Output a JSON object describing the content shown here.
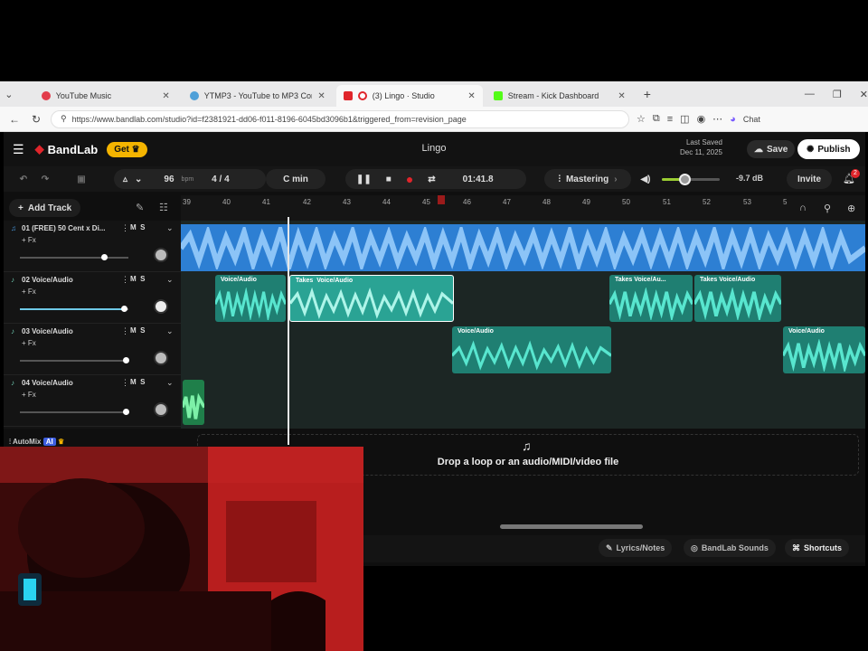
{
  "browser": {
    "tabs": [
      {
        "label": "YouTube Music",
        "color": "#e23c4b"
      },
      {
        "label": "YTMP3 - YouTube to MP3 Convert",
        "color": "#4fa0d8"
      },
      {
        "label": "(3) Lingo · Studio",
        "color": "#e0252b"
      },
      {
        "label": "Stream - Kick Dashboard",
        "color": "#53fc18"
      }
    ],
    "url": "https://www.bandlab.com/studio?id=f2381921-dd06-f011-8196-6045bd3096b1&triggered_from=revision_page",
    "chat_label": "Chat"
  },
  "app": {
    "brand": "BandLab",
    "get_label": "Get",
    "project_title": "Lingo",
    "last_saved_label": "Last Saved",
    "last_saved_date": "Dec 11, 2025",
    "save_label": "Save",
    "publish_label": "Publish",
    "invite_label": "Invite",
    "notif_count": "2"
  },
  "transport": {
    "bpm": "96",
    "bpm_unit": "bpm",
    "time_sig": "4 / 4",
    "key": "C min",
    "time": "01:41.8",
    "mastering_label": "Mastering",
    "volume_db": "-9.7 dB",
    "master_volume_level": 0.38
  },
  "toolbar": {
    "add_track_label": "Add Track"
  },
  "ruler": {
    "bars": [
      "39",
      "40",
      "41",
      "42",
      "43",
      "44",
      "45",
      "46",
      "47",
      "48",
      "49",
      "50",
      "51",
      "52",
      "53",
      "5"
    ]
  },
  "tracks": [
    {
      "name": "01 (FREE) 50 Cent x Di...",
      "fx": "+ Fx",
      "m": "M",
      "s": "S"
    },
    {
      "name": "02 Voice/Audio",
      "fx": "+ Fx",
      "m": "M",
      "s": "S"
    },
    {
      "name": "03 Voice/Audio",
      "fx": "+ Fx",
      "m": "M",
      "s": "S"
    },
    {
      "name": "04 Voice/Audio",
      "fx": "+ Fx",
      "m": "M",
      "s": "S"
    }
  ],
  "clips": {
    "voice_audio": "Voice/Audio",
    "takes": "Takes",
    "voice_au_short": "Voice/Au..."
  },
  "automix": {
    "label": "AutoMix",
    "badge": "AI"
  },
  "dropzone_text": "Drop a loop or an audio/MIDI/video file",
  "bottom": {
    "lyrics": "Lyrics/Notes",
    "sounds": "BandLab Sounds",
    "shortcuts": "Shortcuts"
  },
  "colors": {
    "accent_blue": "#3d8fe0",
    "clip_teal": "#2aa394",
    "wave_teal": "#58e6cf",
    "record_red": "#e0252b",
    "brand_yellow": "#f4b400"
  }
}
